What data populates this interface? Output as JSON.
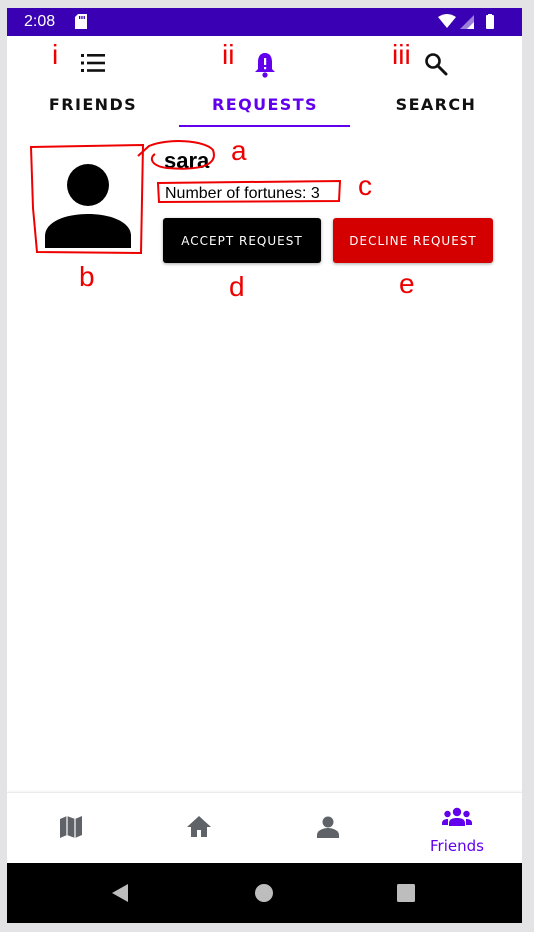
{
  "status_bar": {
    "time": "2:08"
  },
  "tabs": [
    {
      "label": "FRIENDS",
      "icon": "list-icon",
      "annotation": "i"
    },
    {
      "label": "REQUESTS",
      "icon": "bell-alert-icon",
      "annotation": "ii"
    },
    {
      "label": "SEARCH",
      "icon": "search-icon",
      "annotation": "iii"
    }
  ],
  "request": {
    "name": "sara",
    "fortunes_text": "Number of fortunes: 3",
    "accept_label": "ACCEPT REQUEST",
    "decline_label": "DECLINE REQUEST"
  },
  "annotations": {
    "a": "a",
    "b": "b",
    "c": "c",
    "d": "d",
    "e": "e"
  },
  "bottom_nav": {
    "items": [
      {
        "icon": "map-icon"
      },
      {
        "icon": "home-icon"
      },
      {
        "icon": "person-icon"
      },
      {
        "icon": "group-icon",
        "label": "Friends"
      }
    ]
  },
  "colors": {
    "accent": "#6200ee",
    "status_bar": "#3a00b3",
    "decline": "#d40000",
    "annotation": "#ee0000"
  }
}
